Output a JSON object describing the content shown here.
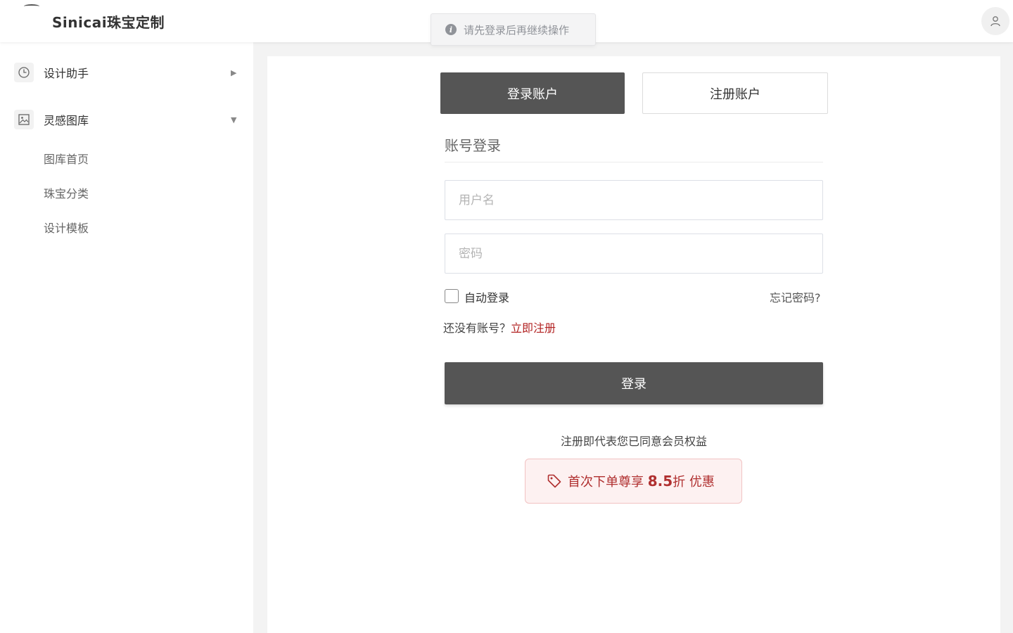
{
  "header": {
    "brand": "Sinicai珠宝定制"
  },
  "toast": {
    "icon": "info-icon",
    "text": "请先登录后再继续操作"
  },
  "sidebar": {
    "items": [
      {
        "label": "设计助手",
        "icon": "clock-icon",
        "arrow": "▶"
      },
      {
        "label": "灵感图库",
        "icon": "image-icon",
        "arrow": "▼",
        "children": [
          {
            "label": "图库首页"
          },
          {
            "label": "珠宝分类"
          },
          {
            "label": "设计模板"
          }
        ]
      }
    ]
  },
  "auth": {
    "tabs": [
      {
        "label": "登录账户",
        "active": true
      },
      {
        "label": "注册账户",
        "active": false
      }
    ],
    "form_title": "账号登录",
    "username_placeholder": "用户名",
    "password_placeholder": "密码",
    "auto_login_label": "自动登录",
    "forgot_label": "忘记密码?",
    "no_account_prefix": "还没有账号？",
    "register_now_label": "立即注册",
    "login_button": "登录",
    "agreement_text": "注册即代表您已同意会员权益",
    "promo": {
      "icon": "tag-icon",
      "prefix": "首次下单尊享 ",
      "number": "8.5",
      "suffix": "折 优惠"
    }
  },
  "colors": {
    "primary_button": "#555555",
    "link_accent": "#b22222",
    "promo_bg": "#fdf1f1",
    "promo_text": "#b03030"
  }
}
